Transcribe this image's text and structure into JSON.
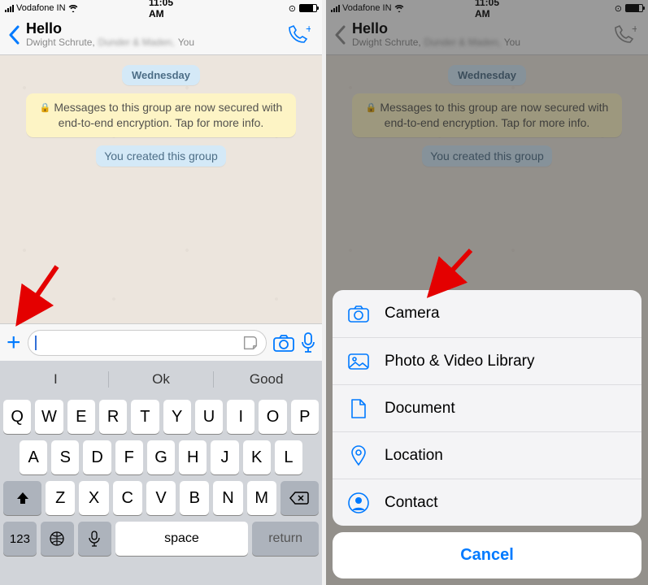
{
  "statusbar": {
    "carrier": "Vodafone IN",
    "time": "11:05 AM"
  },
  "nav": {
    "title": "Hello",
    "subtitle_prefix": "Dwight Schrute,",
    "subtitle_blurred": "Dunder & Maden,",
    "subtitle_suffix": "You"
  },
  "chat": {
    "daychip": "Wednesday",
    "encryption_notice": "Messages to this group are now secured with end-to-end encryption. Tap for more info.",
    "system_message": "You created this group"
  },
  "keyboard": {
    "suggestions": [
      "I",
      "Ok",
      "Good"
    ],
    "row1": [
      "Q",
      "W",
      "E",
      "R",
      "T",
      "Y",
      "U",
      "I",
      "O",
      "P"
    ],
    "row2": [
      "A",
      "S",
      "D",
      "F",
      "G",
      "H",
      "J",
      "K",
      "L"
    ],
    "row3": [
      "Z",
      "X",
      "C",
      "V",
      "B",
      "N",
      "M"
    ],
    "numkey": "123",
    "space": "space",
    "return": "return"
  },
  "sheet": {
    "items": [
      {
        "label": "Camera"
      },
      {
        "label": "Photo & Video Library"
      },
      {
        "label": "Document"
      },
      {
        "label": "Location"
      },
      {
        "label": "Contact"
      }
    ],
    "cancel": "Cancel"
  }
}
